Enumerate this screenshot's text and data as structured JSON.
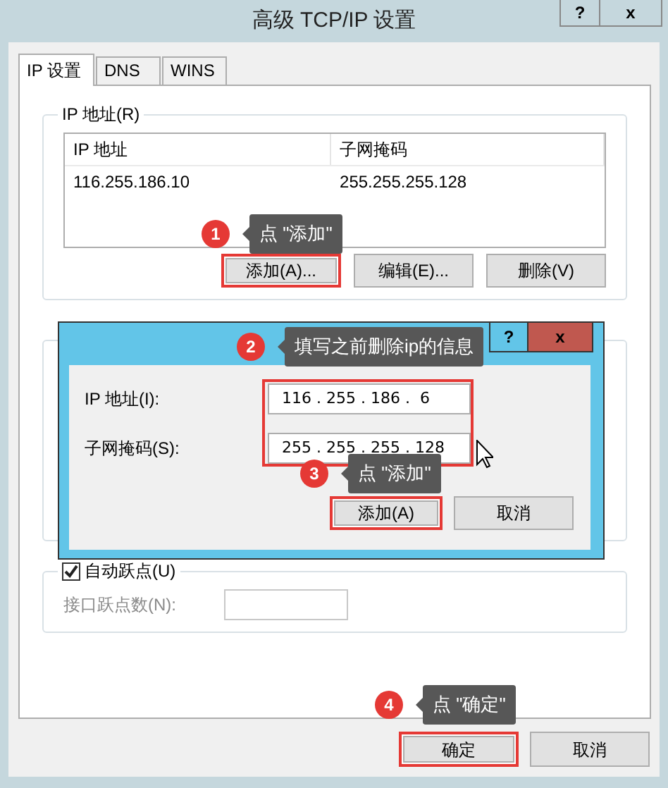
{
  "window": {
    "title": "高级 TCP/IP 设置",
    "help_button": "?",
    "close_button": "x"
  },
  "tabs": [
    {
      "label": "IP 设置",
      "selected": true
    },
    {
      "label": "DNS",
      "selected": false
    },
    {
      "label": "WINS",
      "selected": false
    }
  ],
  "ip_group": {
    "title": "IP 地址(R)",
    "columns": [
      "IP 地址",
      "子网掩码"
    ],
    "rows": [
      [
        "116.255.186.10",
        "255.255.255.128"
      ]
    ],
    "buttons": [
      {
        "label": "添加(A)...",
        "highlighted": true
      },
      {
        "label": "编辑(E)...",
        "highlighted": false
      },
      {
        "label": "删除(V)",
        "highlighted": false
      }
    ]
  },
  "metric_group": {
    "auto_metric": {
      "label": "自动跃点(U)",
      "checked": true
    },
    "interface_metric": {
      "label": "接口跃点数(N):",
      "disabled": true
    }
  },
  "footer_buttons": [
    {
      "label": "确定",
      "highlighted": true
    },
    {
      "label": "取消",
      "highlighted": false
    }
  ],
  "address_dialog": {
    "help_button": "?",
    "close_button": "x",
    "fields_highlighted": true,
    "fields": [
      {
        "label": "IP 地址(I):",
        "value": "116 . 255 . 186 .  6"
      },
      {
        "label": "子网掩码(S):",
        "value": "255 . 255 . 255 . 128"
      }
    ],
    "buttons": [
      {
        "label": "添加(A)",
        "highlighted": true
      },
      {
        "label": "取消",
        "highlighted": false
      }
    ]
  },
  "callouts": [
    {
      "number": "1",
      "text": "点 \"添加\""
    },
    {
      "number": "2",
      "text": "填写之前删除ip的信息"
    },
    {
      "number": "3",
      "text": "点 \"添加\""
    },
    {
      "number": "4",
      "text": "点 \"确定\""
    }
  ]
}
